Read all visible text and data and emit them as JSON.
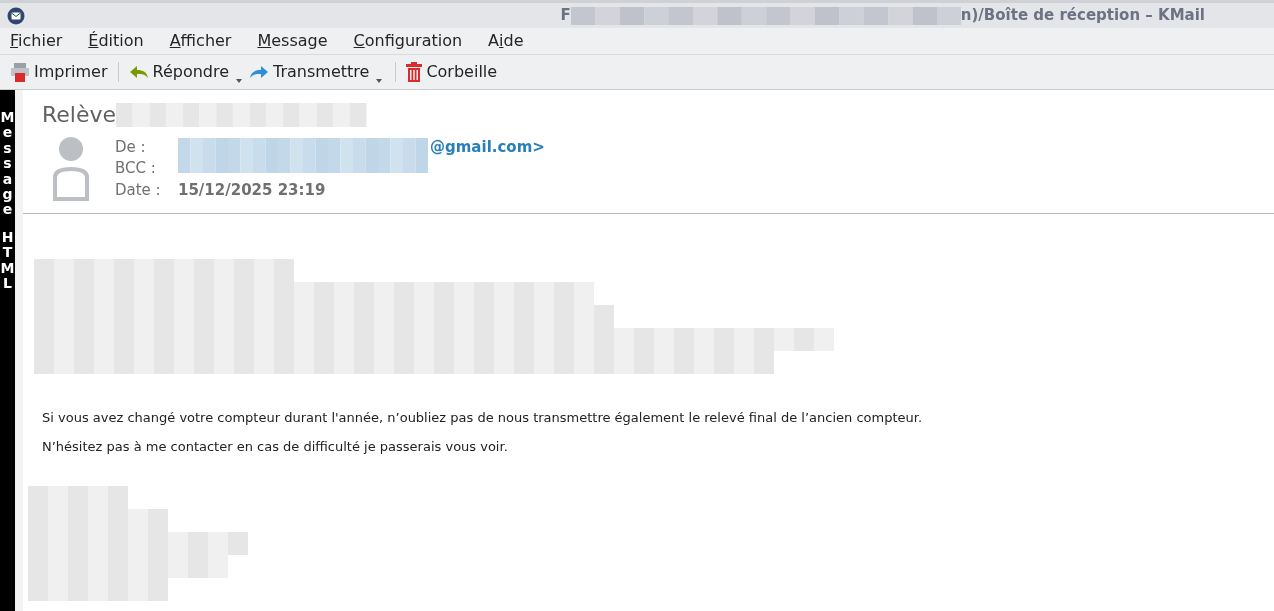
{
  "window": {
    "title_start": "F",
    "title_end": "n)/Boîte de réception – KMail"
  },
  "menu": [
    {
      "key": "F",
      "post": "ichier"
    },
    {
      "key": "É",
      "post": "dition"
    },
    {
      "key": "A",
      "post": "fficher"
    },
    {
      "key": "M",
      "post": "essage"
    },
    {
      "key": "C",
      "post": "onfiguration"
    },
    {
      "pre": "A",
      "key": "i",
      "post": "de"
    }
  ],
  "toolbar": [
    {
      "kind": "print",
      "label": "Imprimer",
      "dropdown": false
    },
    {
      "kind": "reply",
      "label": "Répondre",
      "dropdown": true
    },
    {
      "kind": "forward",
      "label": "Transmettre",
      "dropdown": true
    },
    {
      "kind": "trash",
      "label": "Corbeille",
      "dropdown": false
    }
  ],
  "side_label": "Message HTML",
  "message": {
    "subject": "Relève",
    "from_label": "De :",
    "from_value": "@gmail.com>",
    "bcc_label": "BCC :",
    "date_label": "Date :",
    "date_value": "15/12/2025 23:19",
    "paragraphs": [
      "Si vous avez changé votre compteur durant l'année, n’oubliez pas de nous transmettre également le relevé final de l’ancien compteur.",
      "N’hésitez pas à me contacter en cas de difficulté je passerais vous voir."
    ]
  }
}
